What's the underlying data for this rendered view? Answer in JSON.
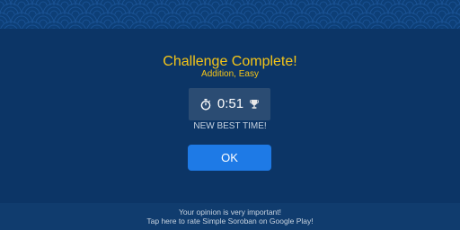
{
  "colors": {
    "background": "#0c3566",
    "pattern_band": "#0d3f77",
    "title": "#f5c518",
    "time_box": "#2b4c73",
    "ok_button": "#1e7ae6",
    "muted_text": "#c8d3e0"
  },
  "dialog": {
    "title": "Challenge Complete!",
    "subtitle": "Addition, Easy",
    "time": {
      "stopwatch_icon": "stopwatch-icon",
      "value": "0:51",
      "trophy_icon": "trophy-icon"
    },
    "best_time_label": "NEW BEST TIME!",
    "ok_label": "OK"
  },
  "footer": {
    "line1": "Your opinion is very important!",
    "line2": "Tap here to rate Simple Soroban on Google Play!"
  }
}
